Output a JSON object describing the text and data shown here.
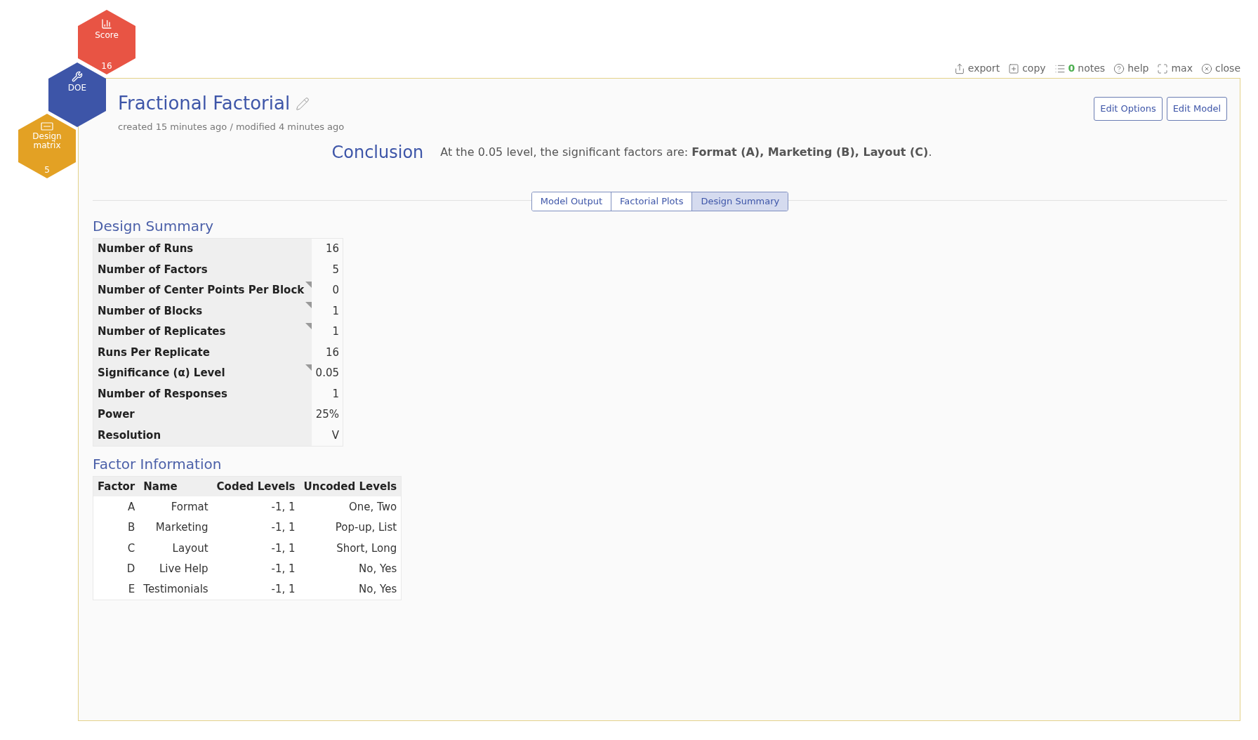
{
  "hexagons": [
    {
      "kind": "score",
      "label": "Score",
      "count": "16",
      "color": "#e85444"
    },
    {
      "kind": "doe",
      "label": "DOE",
      "color": "#3d55a8"
    },
    {
      "kind": "matrix",
      "label": "Design matrix",
      "count": "5",
      "color": "#e3a124"
    }
  ],
  "toolbar": [
    {
      "kind": "export",
      "label": "export"
    },
    {
      "kind": "copy",
      "label": "copy"
    },
    {
      "kind": "notes",
      "count": "0",
      "label": "notes"
    },
    {
      "kind": "help",
      "label": "help"
    },
    {
      "kind": "max",
      "label": "max"
    },
    {
      "kind": "close",
      "label": "close"
    }
  ],
  "header": {
    "title": "Fractional Factorial",
    "meta": "created 15 minutes ago / modified 4 minutes ago",
    "buttons": [
      "Edit Options",
      "Edit Model"
    ]
  },
  "conclusion": {
    "heading": "Conclusion",
    "text": "At the 0.05 level, the significant factors are: **Format (A), Marketing (B), Layout (C)**."
  },
  "tabs": [
    {
      "label": "Model Output",
      "selected": false
    },
    {
      "label": "Factorial Plots",
      "selected": false
    },
    {
      "label": "Design Summary",
      "selected": true
    }
  ],
  "design_summary": {
    "heading": "Design Summary",
    "rows": [
      {
        "label": "Number of Runs",
        "value": "16",
        "flagged": false
      },
      {
        "label": "Number of Factors",
        "value": "5",
        "flagged": false
      },
      {
        "label": "Number of Center Points Per Block",
        "value": "0",
        "flagged": true
      },
      {
        "label": "Number of Blocks",
        "value": "1",
        "flagged": true
      },
      {
        "label": "Number of Replicates",
        "value": "1",
        "flagged": true
      },
      {
        "label": "Runs Per Replicate",
        "value": "16",
        "flagged": false
      },
      {
        "label": "Significance (α) Level",
        "value": "0.05",
        "flagged": true
      },
      {
        "label": "Number of Responses",
        "value": "1",
        "flagged": false
      },
      {
        "label": "Power",
        "value": "25%",
        "flagged": false
      },
      {
        "label": "Resolution",
        "value": "V",
        "flagged": false
      }
    ]
  },
  "factor_information": {
    "heading": "Factor Information",
    "columns": [
      "Factor",
      "Name",
      "Coded Levels",
      "Uncoded Levels"
    ],
    "rows": [
      [
        "A",
        "Format",
        "-1, 1",
        "One, Two"
      ],
      [
        "B",
        "Marketing",
        "-1, 1",
        "Pop-up, List"
      ],
      [
        "C",
        "Layout",
        "-1, 1",
        "Short, Long"
      ],
      [
        "D",
        "Live Help",
        "-1, 1",
        "No, Yes"
      ],
      [
        "E",
        "Testimonials",
        "-1, 1",
        "No, Yes"
      ]
    ]
  }
}
